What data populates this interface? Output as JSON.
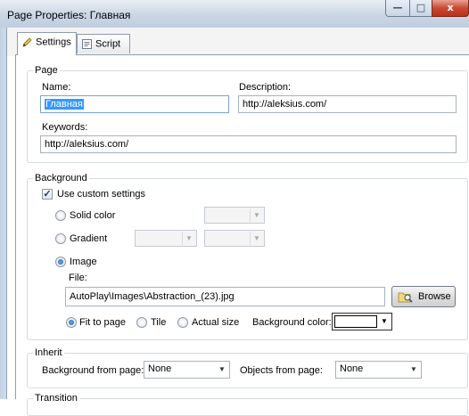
{
  "window": {
    "title": "Page Properties: Главная",
    "controls": {
      "minimize": "—",
      "maximize": "□",
      "close": "x"
    }
  },
  "tabs": [
    {
      "label": "Settings",
      "icon": "pencil-icon",
      "active": true
    },
    {
      "label": "Script",
      "icon": "script-icon",
      "active": false
    }
  ],
  "page_group": {
    "legend": "Page",
    "name_label": "Name:",
    "name_value": "Главная",
    "description_label": "Description:",
    "description_value": "http://aleksius.com/",
    "keywords_label": "Keywords:",
    "keywords_value": "http://aleksius.com/"
  },
  "background_group": {
    "legend": "Background",
    "use_custom_label": "Use custom settings",
    "use_custom_checked": true,
    "solid_color_label": "Solid color",
    "gradient_label": "Gradient",
    "image_label": "Image",
    "selected": "image",
    "file_label": "File:",
    "file_value": "AutoPlay\\Images\\Abstraction_(23).jpg",
    "browse_label": "Browse",
    "fit_to_page_label": "Fit to page",
    "tile_label": "Tile",
    "actual_size_label": "Actual size",
    "image_mode": "fit_to_page",
    "bg_color_label": "Background color:",
    "bg_color_value": "#ffffff"
  },
  "inherit_group": {
    "legend": "Inherit",
    "bg_from_label": "Background from page:",
    "bg_from_value": "None",
    "objects_from_label": "Objects from page:",
    "objects_from_value": "None"
  },
  "transition_group": {
    "legend": "Transition"
  },
  "colors": {
    "selection": "#3399ff",
    "close_button": "#c94a32"
  }
}
